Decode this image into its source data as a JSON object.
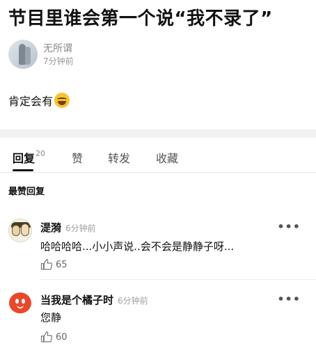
{
  "post": {
    "title": "节目里谁会第一个说“我不录了”",
    "author": {
      "name": "无所谓",
      "time": "7分钟前"
    },
    "body": "肯定会有",
    "body_emoji": "laughing-tears-emoji"
  },
  "tabs": [
    {
      "label": "回复",
      "count": "20",
      "active": true
    },
    {
      "label": "赞",
      "active": false
    },
    {
      "label": "转发",
      "active": false
    },
    {
      "label": "收藏",
      "active": false
    }
  ],
  "section": {
    "title": "最赞回复"
  },
  "comments": [
    {
      "name": "湜漪",
      "time": "6分钟前",
      "text": "哈哈哈哈...小小声说..会不会是静静子呀...",
      "likes": "65",
      "more": "•••"
    },
    {
      "name": "当我是个橘子时",
      "time": "6分钟前",
      "text": "您静",
      "likes": "60",
      "more": "•••"
    }
  ],
  "colors": {
    "text": "#111111",
    "muted": "#9a9a9a",
    "divider": "#f2f2f2",
    "accent_avatar": "#e9482a"
  }
}
